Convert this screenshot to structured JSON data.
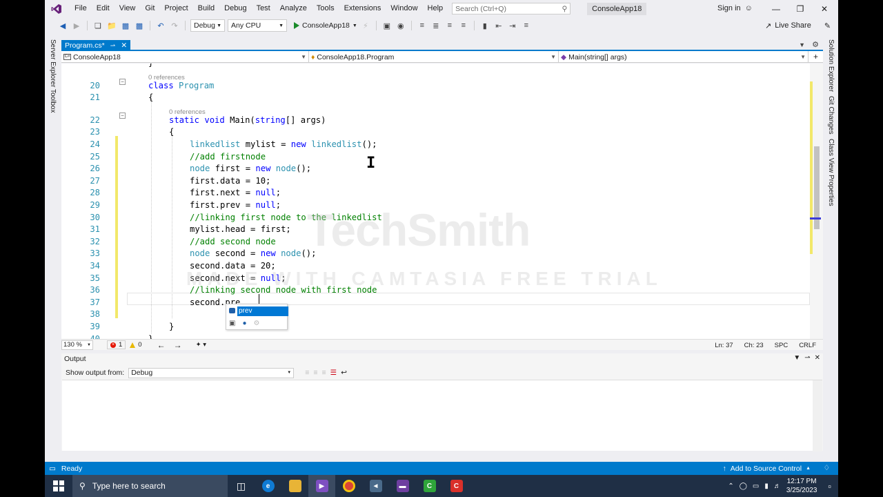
{
  "menu": {
    "items": [
      "File",
      "Edit",
      "View",
      "Git",
      "Project",
      "Build",
      "Debug",
      "Test",
      "Analyze",
      "Tools",
      "Extensions",
      "Window",
      "Help"
    ],
    "search_placeholder": "Search (Ctrl+Q)",
    "solution_name": "ConsoleApp18",
    "sign_in": "Sign in"
  },
  "toolbar": {
    "config": "Debug",
    "platform": "Any CPU",
    "run_target": "ConsoleApp18",
    "live_share": "Live Share"
  },
  "side_panels": {
    "left": [
      "Server Explorer",
      "Toolbox"
    ],
    "right": [
      "Solution Explorer",
      "Git Changes",
      "Class View",
      "Properties"
    ]
  },
  "document_tab": {
    "label": "Program.cs*"
  },
  "navbar": {
    "project": "ConsoleApp18",
    "class": "ConsoleApp18.Program",
    "member": "Main(string[] args)"
  },
  "editor": {
    "refs_label": "0 references",
    "lines": [
      {
        "n": "",
        "tokens": [
          {
            "c": "tx",
            "t": "}"
          }
        ]
      },
      {
        "n": "20",
        "tokens": [
          {
            "c": "kw",
            "t": "class "
          },
          {
            "c": "ty",
            "t": "Program"
          }
        ]
      },
      {
        "n": "21",
        "tokens": [
          {
            "c": "tx",
            "t": "{"
          }
        ]
      },
      {
        "n": "22",
        "tokens": [
          {
            "c": "kw",
            "t": "static void "
          },
          {
            "c": "tx",
            "t": "Main("
          },
          {
            "c": "kw",
            "t": "string"
          },
          {
            "c": "tx",
            "t": "[] args)"
          }
        ]
      },
      {
        "n": "23",
        "tokens": [
          {
            "c": "tx",
            "t": "{"
          }
        ]
      },
      {
        "n": "24",
        "tokens": [
          {
            "c": "ty",
            "t": "linkedlist"
          },
          {
            "c": "tx",
            "t": " mylist = "
          },
          {
            "c": "kw",
            "t": "new "
          },
          {
            "c": "ty",
            "t": "linkedlist"
          },
          {
            "c": "tx",
            "t": "();"
          }
        ]
      },
      {
        "n": "25",
        "tokens": [
          {
            "c": "cm",
            "t": "//add firstnode"
          }
        ]
      },
      {
        "n": "26",
        "tokens": [
          {
            "c": "ty",
            "t": "node"
          },
          {
            "c": "tx",
            "t": " first = "
          },
          {
            "c": "kw",
            "t": "new "
          },
          {
            "c": "ty",
            "t": "node"
          },
          {
            "c": "tx",
            "t": "();"
          }
        ]
      },
      {
        "n": "27",
        "tokens": [
          {
            "c": "tx",
            "t": "first.data = 10;"
          }
        ]
      },
      {
        "n": "28",
        "tokens": [
          {
            "c": "tx",
            "t": "first.next = "
          },
          {
            "c": "kw",
            "t": "null"
          },
          {
            "c": "tx",
            "t": ";"
          }
        ]
      },
      {
        "n": "29",
        "tokens": [
          {
            "c": "tx",
            "t": "first.prev = "
          },
          {
            "c": "kw",
            "t": "null"
          },
          {
            "c": "tx",
            "t": ";"
          }
        ]
      },
      {
        "n": "30",
        "tokens": [
          {
            "c": "cm",
            "t": "//linking first node to the linkedlist"
          }
        ]
      },
      {
        "n": "31",
        "tokens": [
          {
            "c": "tx",
            "t": "mylist.head = first;"
          }
        ]
      },
      {
        "n": "32",
        "tokens": [
          {
            "c": "cm",
            "t": "//add second node"
          }
        ]
      },
      {
        "n": "33",
        "tokens": [
          {
            "c": "ty",
            "t": "node"
          },
          {
            "c": "tx",
            "t": " second = "
          },
          {
            "c": "kw",
            "t": "new "
          },
          {
            "c": "ty",
            "t": "node"
          },
          {
            "c": "tx",
            "t": "();"
          }
        ]
      },
      {
        "n": "34",
        "tokens": [
          {
            "c": "tx",
            "t": "second.data = 20;"
          }
        ]
      },
      {
        "n": "35",
        "tokens": [
          {
            "c": "tx",
            "t": "second.next = "
          },
          {
            "c": "kw",
            "t": "null"
          },
          {
            "c": "tx",
            "t": ";"
          }
        ]
      },
      {
        "n": "36",
        "tokens": [
          {
            "c": "cm",
            "t": "//linking second node with first node"
          }
        ]
      },
      {
        "n": "37",
        "tokens": [
          {
            "c": "tx",
            "t": "second.pre"
          }
        ]
      },
      {
        "n": "38",
        "tokens": []
      },
      {
        "n": "39",
        "tokens": [
          {
            "c": "tx",
            "t": "}"
          }
        ]
      },
      {
        "n": "40",
        "tokens": [
          {
            "c": "tx",
            "t": "}"
          }
        ]
      }
    ]
  },
  "intellisense": {
    "selected": "prev"
  },
  "watermark": {
    "line1": "TechSmith",
    "line2": "MADE WITH CAMTASIA FREE TRIAL"
  },
  "editor_status": {
    "zoom": "130 %",
    "errors": "1",
    "warnings": "0",
    "line": "Ln: 37",
    "col": "Ch: 23",
    "spc": "SPC",
    "eol": "CRLF"
  },
  "output": {
    "title": "Output",
    "show_from_label": "Show output from:",
    "source": "Debug"
  },
  "statusbar": {
    "ready": "Ready",
    "source_control": "Add to Source Control"
  },
  "taskbar": {
    "search_placeholder": "Type here to search",
    "time": "12:17 PM",
    "date": "3/25/2023"
  },
  "colors": {
    "accent": "#007acc",
    "keyword": "#0000ff",
    "type": "#2b91af",
    "comment": "#008000",
    "taskbar": "#1f2f45"
  }
}
